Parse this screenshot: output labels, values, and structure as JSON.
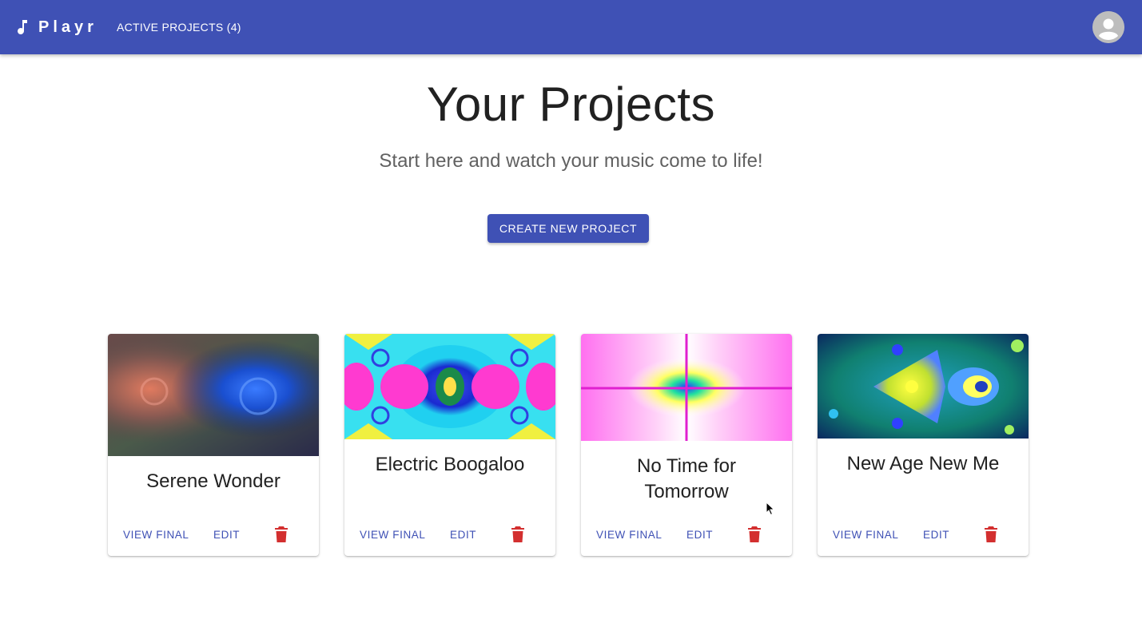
{
  "appbar": {
    "brand": "Playr",
    "brand_icon": "music-note-icon",
    "nav_link": "ACTIVE PROJECTS (4)",
    "avatar_icon": "account-circle-icon",
    "color": "#3f51b5"
  },
  "main": {
    "title": "Your Projects",
    "subtitle": "Start here and watch your music come to life!",
    "create_button": "CREATE NEW PROJECT"
  },
  "projects": [
    {
      "title": "Serene Wonder",
      "view_label": "VIEW FINAL",
      "edit_label": "EDIT",
      "delete_icon": "trash-icon"
    },
    {
      "title": "Electric Boogaloo",
      "view_label": "VIEW FINAL",
      "edit_label": "EDIT",
      "delete_icon": "trash-icon"
    },
    {
      "title": "No Time for Tomorrow",
      "view_label": "VIEW FINAL",
      "edit_label": "EDIT",
      "delete_icon": "trash-icon"
    },
    {
      "title": "New Age New Me",
      "view_label": "VIEW FINAL",
      "edit_label": "EDIT",
      "delete_icon": "trash-icon"
    }
  ],
  "colors": {
    "primary": "#3f51b5",
    "delete": "#d32f2f",
    "title_text": "#212121",
    "subtitle_text": "#616161"
  }
}
